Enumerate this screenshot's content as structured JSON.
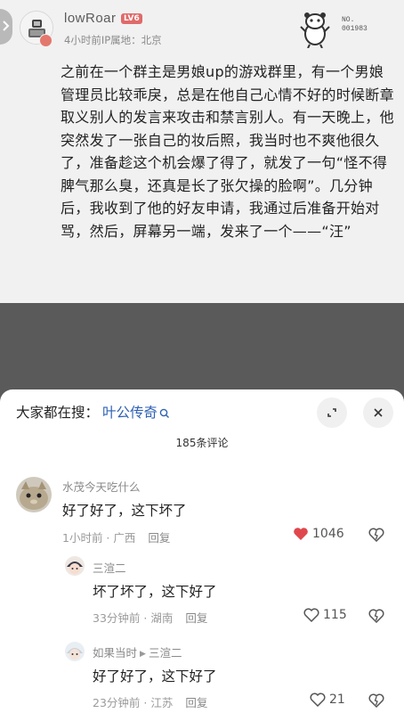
{
  "post": {
    "username": "lowRoar",
    "level": "LV6",
    "time": "4小时前",
    "ip_location": "IP属地：北京",
    "sticker_no": "NO.",
    "sticker_code": "001983",
    "text": "之前在一个群主是男娘up的游戏群里，有一个男娘管理员比较乖戾，总是在他自己心情不好的时候断章取义别人的发言来攻击和禁言别人。有一天晚上，他突然发了一张自己的妆后照，我当时也不爽他很久了，准备趁这个机会爆了得了，就发了一句“怪不得脾气那么臭，还真是长了张欠操的脸啊”。几分钟后，我收到了他的好友申请，我通过后准备开始对骂，然后，屏幕另一端，发来了一个——“汪”"
  },
  "sheet": {
    "search_prefix": "大家都在搜：",
    "search_link": "叶公传奇",
    "comment_count": "185条评论"
  },
  "comments": [
    {
      "name": "水茂今天吃什么",
      "text": "好了好了，这下坏了",
      "time": "1小时前",
      "location": "广西",
      "reply": "回复",
      "likes": "1046",
      "liked": true
    },
    {
      "name": "三渲二",
      "text": "坏了坏了，这下好了",
      "time": "33分钟前",
      "location": "湖南",
      "reply": "回复",
      "likes": "115",
      "liked": false
    },
    {
      "name": "如果当时",
      "reply_to": "三渲二",
      "text": "好了好了，这下好了",
      "time": "23分钟前",
      "location": "江苏",
      "reply": "回复",
      "likes": "21",
      "liked": false
    }
  ],
  "colors": {
    "like_red": "#e0474c",
    "link_blue": "#2f62b5",
    "level_badge": "#e06a6a"
  }
}
